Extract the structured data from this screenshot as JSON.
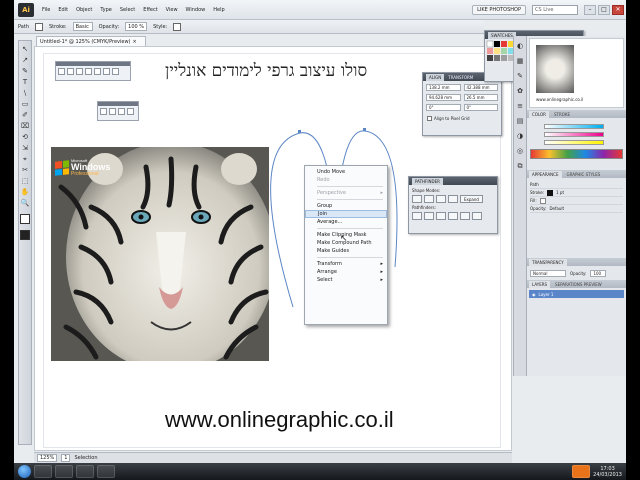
{
  "menubar": {
    "logo": "Ai",
    "items": [
      "File",
      "Edit",
      "Object",
      "Type",
      "Select",
      "Effect",
      "View",
      "Window",
      "Help"
    ],
    "workspace": "LIKE PHOTOSHOP",
    "search_placeholder": "CS Live"
  },
  "control_bar": {
    "label": "Path",
    "stroke_label": "Stroke:",
    "opacity_label": "Opacity:",
    "brush_field": "Basic",
    "style_label": "Style:",
    "width_value": "100 %"
  },
  "document_tab": {
    "title": "Untitled-1* @ 125% (CMYK/Preview)"
  },
  "tools": [
    "↖",
    "↗",
    "✎",
    "T",
    "\\",
    "▭",
    "✐",
    "⌧",
    "⟲",
    "⇲",
    "⌖",
    "✂",
    "⬚",
    "✋",
    "🔍"
  ],
  "canvas": {
    "hebrew_title": "סולו עיצוב גרפי לימודים אונליין",
    "website": "www.onlinegraphic.co.il",
    "tiger_logo": {
      "small": "Microsoft",
      "big": "Windows",
      "pro": "Professional"
    }
  },
  "context_menu": {
    "items": [
      {
        "label": "Undo Move",
        "enabled": true
      },
      {
        "label": "Redo",
        "enabled": false
      },
      {
        "sep": true
      },
      {
        "label": "Perspective",
        "enabled": false,
        "submenu": true
      },
      {
        "sep": true
      },
      {
        "label": "Group",
        "enabled": true
      },
      {
        "label": "Join",
        "enabled": true,
        "hover": true
      },
      {
        "label": "Average...",
        "enabled": true
      },
      {
        "sep": true
      },
      {
        "label": "Make Clipping Mask",
        "enabled": true
      },
      {
        "label": "Make Compound Path",
        "enabled": true
      },
      {
        "label": "Make Guides",
        "enabled": true
      },
      {
        "sep": true
      },
      {
        "label": "Transform",
        "enabled": true,
        "submenu": true
      },
      {
        "label": "Arrange",
        "enabled": true,
        "submenu": true
      },
      {
        "label": "Select",
        "enabled": true,
        "submenu": true
      }
    ]
  },
  "transform_panel": {
    "tabs": [
      "ALIGN",
      "TRANSFORM"
    ],
    "x_value": "138.2 mm",
    "y_value": "94.628 mm",
    "w_value": "42.388 mm",
    "h_value": "26.5 mm",
    "angle": "0°",
    "shear": "0°",
    "align_checkbox": "Align to Pixel Grid"
  },
  "pathfinder_panel": {
    "tab": "PATHFINDER",
    "shape_modes": "Shape Modes:",
    "expand": "Expand",
    "pathfinders": "Pathfinders:"
  },
  "swatches_panel": {
    "tab": "SWATCHES"
  },
  "navigator": {
    "caption": "www.onlinegraphic.co.il"
  },
  "color_panel": {
    "tabs": [
      "COLOR",
      "STROKE"
    ]
  },
  "appearance_panel": {
    "tabs": [
      "APPEARANCE",
      "GRAPHIC STYLES"
    ],
    "rows": [
      "Path",
      "Stroke:",
      "Fill:",
      "Opacity:"
    ],
    "stroke_weight": "1 pt",
    "opacity_value": "Default"
  },
  "transparency_panel": {
    "tab": "TRANSPARENCY",
    "mode": "Normal",
    "opacity_label": "Opacity:",
    "opacity": "100"
  },
  "layers_panel": {
    "tabs": [
      "LAYERS",
      "SEPARATIONS PREVIEW"
    ],
    "layer_name": "Layer 1"
  },
  "statusbar": {
    "zoom": "125%",
    "page": "1",
    "mode": "Selection"
  },
  "taskbar": {
    "time": "17:03",
    "date": "24/03/2013"
  },
  "colors": {
    "accent": "#5a86c9",
    "menu_hover": "#d9e7f7",
    "taskbar": "#15181c"
  }
}
